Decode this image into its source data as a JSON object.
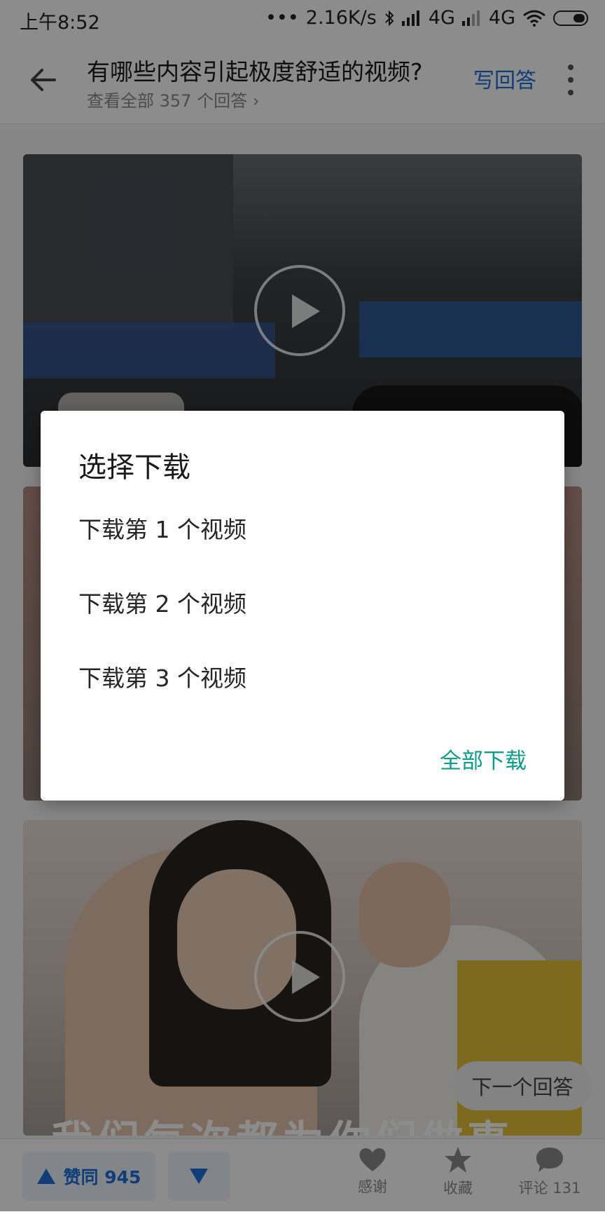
{
  "status_bar": {
    "time": "上午8:52",
    "network_speed": "2.16K/s",
    "network_1": "4G",
    "network_2": "4G",
    "icons": [
      "dots-icon",
      "bluetooth-icon",
      "signal-icon",
      "signal-icon",
      "wifi-icon",
      "battery-icon"
    ]
  },
  "app_bar": {
    "title": "有哪些内容引起极度舒适的视频?",
    "subtitle": "查看全部 357 个回答 ›",
    "write_answer": "写回答",
    "accent_color": "#1e6fd9"
  },
  "media": {
    "subtitle_overlay": "我们每次都为你们做事"
  },
  "next_answer": "下一个回答",
  "bottom_bar": {
    "upvote_label": "赞同 945",
    "thanks_label": "感谢",
    "favorite_label": "收藏",
    "comment_label": "评论 131"
  },
  "dialog": {
    "title": "选择下载",
    "options": [
      {
        "label": "下载第 1 个视频"
      },
      {
        "label": "下载第 2 个视频"
      },
      {
        "label": "下载第 3 个视频"
      }
    ],
    "download_all": "全部下载",
    "action_color": "#0f9d8b"
  }
}
